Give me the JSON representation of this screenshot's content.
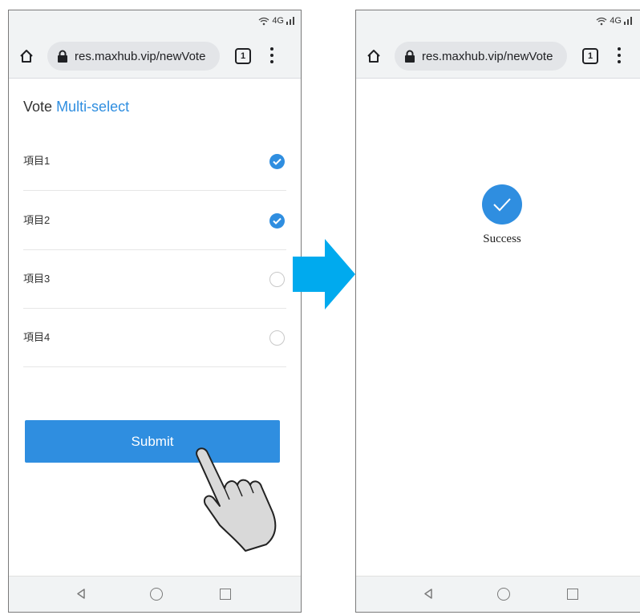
{
  "colors": {
    "accent": "#2f8ee0",
    "arrow": "#00aaee"
  },
  "status": {
    "network": "4G"
  },
  "browser": {
    "url": "res.maxhub.vip/newVote",
    "tab_count": "1"
  },
  "vote": {
    "title_prefix": "Vote",
    "title_mode": "Multi-select",
    "options": [
      {
        "label": "項目1",
        "selected": true
      },
      {
        "label": "項目2",
        "selected": true
      },
      {
        "label": "項目3",
        "selected": false
      },
      {
        "label": "項目4",
        "selected": false
      }
    ],
    "submit_label": "Submit"
  },
  "result": {
    "message": "Success"
  },
  "icons": [
    "home-icon",
    "lock-icon",
    "tab-switcher-icon",
    "more-menu-icon",
    "checkmark-icon",
    "back-icon",
    "home-circle-icon",
    "recents-icon",
    "pointing-hand-icon",
    "flow-arrow-icon",
    "wifi-icon",
    "signal-icon"
  ]
}
